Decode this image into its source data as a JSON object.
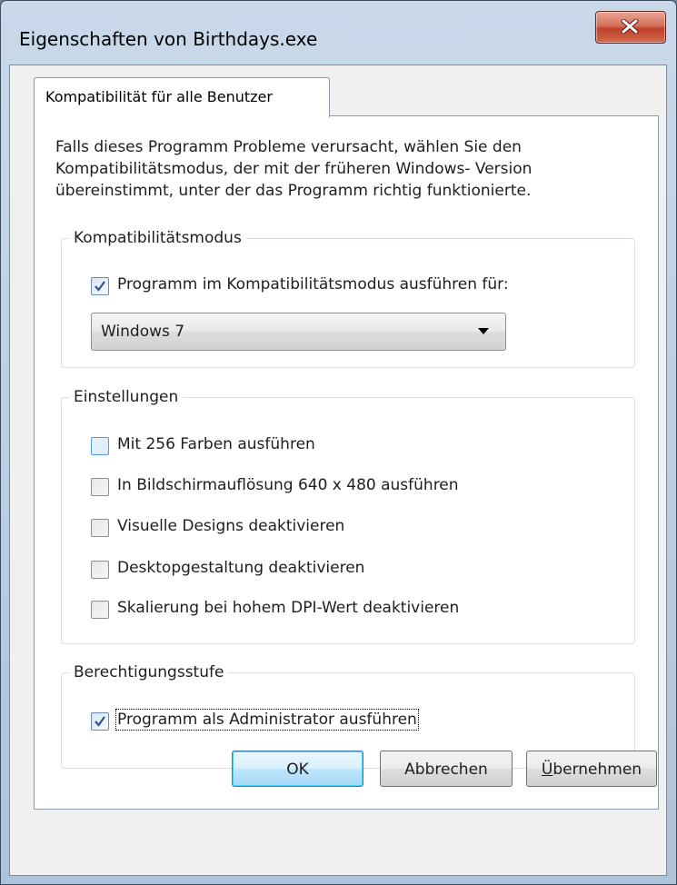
{
  "window": {
    "title": "Eigenschaften von Birthdays.exe"
  },
  "tab": {
    "label": "Kompatibilität für alle Benutzer"
  },
  "intro": {
    "line1": "Falls dieses Programm Probleme verursacht, wählen Sie den",
    "line2": "Kompatibilitätsmodus, der mit der früheren Windows- Version",
    "line3": "übereinstimmt, unter der das Programm richtig funktionierte."
  },
  "compat_group": {
    "legend": "Kompatibilitätsmodus",
    "checkbox_label": "Programm im Kompatibilitätsmodus ausführen für:",
    "checked": true,
    "select_value": "Windows 7"
  },
  "settings_group": {
    "legend": "Einstellungen",
    "options": [
      {
        "label": "Mit 256 Farben ausführen",
        "checked": false
      },
      {
        "label": "In Bildschirmauflösung 640 x 480 ausführen",
        "checked": false
      },
      {
        "label": "Visuelle Designs deaktivieren",
        "checked": false
      },
      {
        "label": "Desktopgestaltung deaktivieren",
        "checked": false
      },
      {
        "label": "Skalierung bei hohem DPI-Wert deaktivieren",
        "checked": false
      }
    ]
  },
  "privilege_group": {
    "legend": "Berechtigungsstufe",
    "checkbox_label": "Programm als Administrator ausführen",
    "checked": true
  },
  "buttons": {
    "ok": "OK",
    "cancel": "Abbrechen",
    "apply_accel": "Ü",
    "apply_rest": "bernehmen"
  },
  "colors": {
    "accent": "#3c7fb1",
    "close": "#c0422a"
  }
}
